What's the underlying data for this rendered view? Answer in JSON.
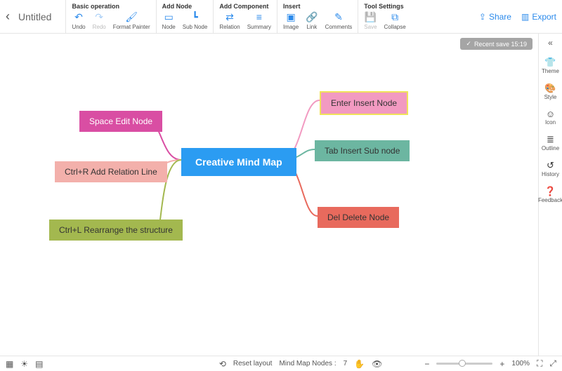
{
  "header": {
    "title": "Untitled",
    "groups": {
      "basic": {
        "title": "Basic operation",
        "undo": "Undo",
        "redo": "Redo",
        "format": "Format Painter"
      },
      "addnode": {
        "title": "Add Node",
        "node": "Node",
        "subnode": "Sub Node"
      },
      "addcomp": {
        "title": "Add Component",
        "relation": "Relation",
        "summary": "Summary"
      },
      "insert": {
        "title": "Insert",
        "image": "Image",
        "link": "Link",
        "comments": "Comments"
      },
      "toolset": {
        "title": "Tool Settings",
        "save": "Save",
        "collapse": "Collapse"
      }
    },
    "share": "Share",
    "export": "Export"
  },
  "canvas": {
    "recent_save": "Recent save 15:19",
    "center": "Creative Mind Map",
    "nodes": {
      "right1": "Enter Insert Node",
      "right2": "Tab Insert Sub node",
      "right3": "Del Delete Node",
      "left1": "Space Edit Node",
      "left2": "Ctrl+R Add Relation Line",
      "left3": "Ctrl+L Rearrange the structure"
    }
  },
  "sidebar": {
    "theme": "Theme",
    "style": "Style",
    "icon": "Icon",
    "outline": "Outline",
    "history": "History",
    "feedback": "Feedback"
  },
  "footer": {
    "reset": "Reset layout",
    "nodes_label": "Mind Map Nodes :",
    "nodes_count": "7",
    "zoom": "100%"
  }
}
